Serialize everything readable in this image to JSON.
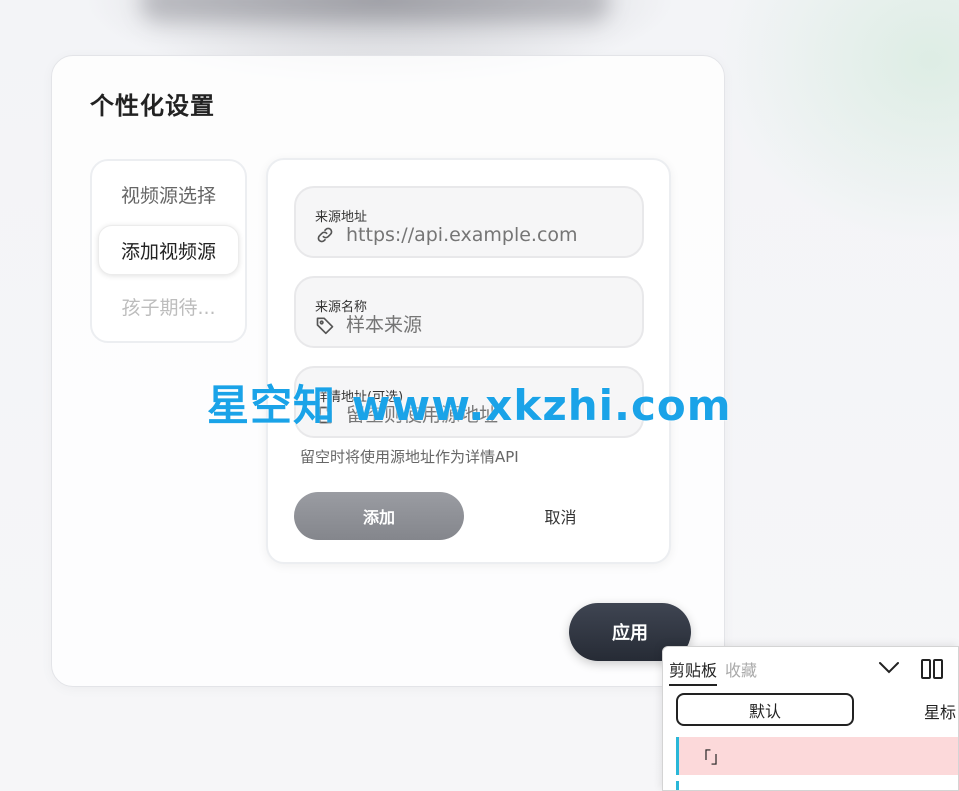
{
  "card": {
    "title": "个性化设置",
    "side_tabs": [
      {
        "label": "视频源选择"
      },
      {
        "label": "添加视频源"
      },
      {
        "label": "孩子期待..."
      }
    ],
    "form": {
      "fields": [
        {
          "label": "来源地址",
          "placeholder": "https://api.example.com",
          "icon": "link-icon"
        },
        {
          "label": "来源名称",
          "placeholder": "样本来源",
          "icon": "tag-icon"
        },
        {
          "label": "详情地址(可选)",
          "placeholder": "留空则使用源地址",
          "icon": "document-icon"
        }
      ],
      "hint": "留空时将使用源地址作为详情API",
      "add_label": "添加",
      "cancel_label": "取消"
    },
    "apply_label": "应用"
  },
  "watermark": "星空知 www.xkzhi.com",
  "clipboard": {
    "tabs": [
      "剪贴板",
      "收藏"
    ],
    "default_label": "默认",
    "starred_label": "星标",
    "item": "「」"
  },
  "colors": {
    "accent_dark": "#2b303b",
    "watermark": "#1aa3e8",
    "clip_highlight": "#fcd9da",
    "clip_marker": "#2ab7d8"
  }
}
